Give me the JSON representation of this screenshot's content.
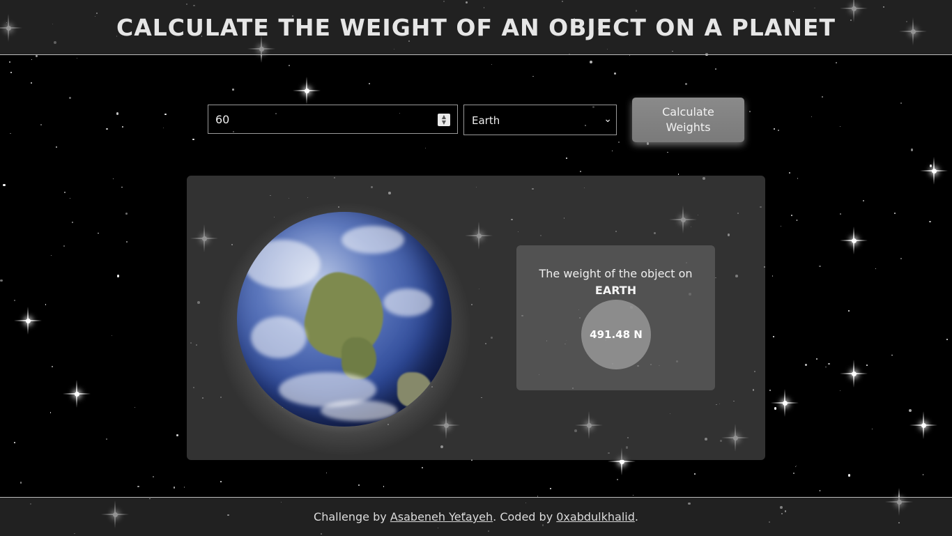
{
  "header": {
    "title": "CALCULATE THE WEIGHT OF AN OBJECT ON A PLANET"
  },
  "form": {
    "mass_value": "60",
    "planet_selected": "Earth",
    "calculate_label": "Calculate Weights"
  },
  "result": {
    "line1": "The weight of the object on",
    "planet_name": "EARTH",
    "weight": "491.48 N",
    "planet_image": "earth-globe"
  },
  "footer": {
    "prefix": "Challenge by ",
    "author_link": "Asabeneh Yetayeh",
    "middle": ". Coded by ",
    "coder_link": "0xabdulkhalid",
    "suffix": "."
  },
  "colors": {
    "background": "#000000",
    "panel": "#505050",
    "button": "#808080"
  }
}
